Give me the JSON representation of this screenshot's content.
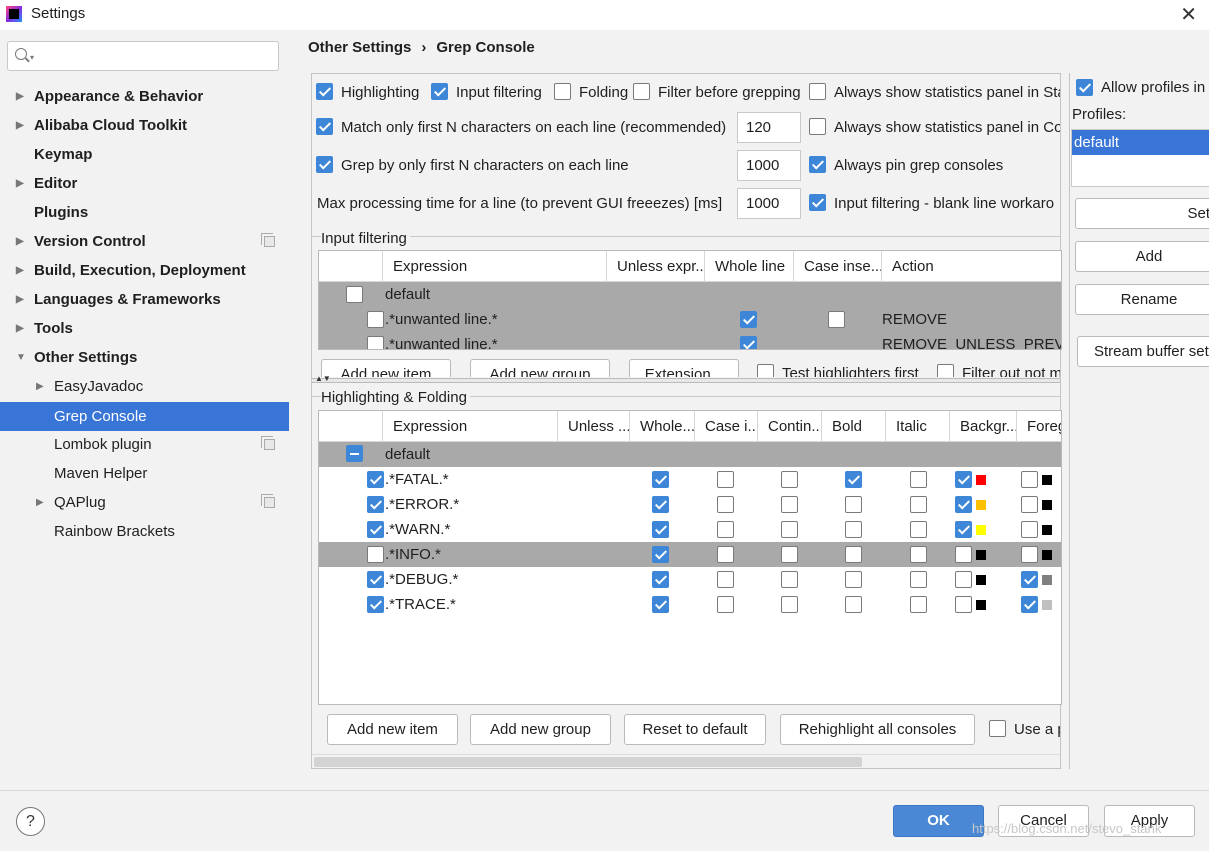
{
  "window": {
    "title": "Settings",
    "close_glyph": "✕"
  },
  "sidebar": {
    "search_placeholder": "",
    "items": [
      {
        "label": "Appearance & Behavior",
        "bold": true,
        "arrow": "▶"
      },
      {
        "label": "Alibaba Cloud Toolkit",
        "bold": true,
        "arrow": "▶"
      },
      {
        "label": "Keymap",
        "bold": true
      },
      {
        "label": "Editor",
        "bold": true,
        "arrow": "▶"
      },
      {
        "label": "Plugins",
        "bold": true
      },
      {
        "label": "Version Control",
        "bold": true,
        "arrow": "▶"
      },
      {
        "label": "Build, Execution, Deployment",
        "bold": true,
        "arrow": "▶"
      },
      {
        "label": "Languages & Frameworks",
        "bold": true,
        "arrow": "▶"
      },
      {
        "label": "Tools",
        "bold": true,
        "arrow": "▶"
      },
      {
        "label": "Other Settings",
        "bold": true,
        "arrow": "▼"
      },
      {
        "label": "EasyJavadoc",
        "arrow": "▶"
      },
      {
        "label": "Grep Console",
        "selected": true
      },
      {
        "label": "Lombok plugin"
      },
      {
        "label": "Maven Helper"
      },
      {
        "label": "QAPlug",
        "arrow": "▶"
      },
      {
        "label": "Rainbow Brackets"
      }
    ]
  },
  "breadcrumb": {
    "parent": "Other Settings",
    "separator": "›",
    "current": "Grep Console"
  },
  "options": {
    "highlighting": "Highlighting",
    "input_filtering": "Input filtering",
    "folding": "Folding",
    "filter_before": "Filter before grepping",
    "always_stats_sta": "Always show statistics panel in Sta",
    "match_first_n": "Match only first N characters on each line (recommended)",
    "match_first_n_value": "120",
    "always_stats_co": "Always show statistics panel in Co",
    "grep_first_n": "Grep by only first N characters on each line",
    "grep_first_n_value": "1000",
    "always_pin": "Always pin grep consoles",
    "max_processing": "Max processing time for a line (to prevent GUI freeezes) [ms]",
    "max_processing_value": "1000",
    "blank_line": "Input filtering - blank line workaro"
  },
  "input_filtering": {
    "title": "Input filtering",
    "headers": [
      "Expression",
      "Unless expr...",
      "Whole line",
      "Case inse...",
      "Action"
    ],
    "rows": [
      {
        "expression": "default",
        "action": ""
      },
      {
        "expression": ".*unwanted line.*",
        "action": "REMOVE"
      },
      {
        "expression": ".*unwanted line.*",
        "action": "REMOVE_UNLESS_PREVIOU"
      }
    ],
    "buttons": {
      "add_item": "Add new item",
      "add_group": "Add new group",
      "extension": "Extension...",
      "test_first": "Test highlighters first",
      "filter_out": "Filter out not m"
    }
  },
  "highlighting": {
    "title": "Highlighting & Folding",
    "headers": [
      "Expression",
      "Unless ...",
      "Whole...",
      "Case i...",
      "Contin...",
      "Bold",
      "Italic",
      "Backgr...",
      "Foreg"
    ],
    "group": "default",
    "rows": [
      {
        "expression": ".*FATAL.*",
        "bg_color": "#ff0000",
        "fg_color": "#000000"
      },
      {
        "expression": ".*ERROR.*",
        "bg_color": "#ffc000",
        "fg_color": "#000000"
      },
      {
        "expression": ".*WARN.*",
        "bg_color": "#ffff00",
        "fg_color": "#000000"
      },
      {
        "expression": ".*INFO.*",
        "bg_color": "#000000",
        "fg_color": "#000000"
      },
      {
        "expression": ".*DEBUG.*",
        "bg_color": "#000000",
        "fg_color": "#808080"
      },
      {
        "expression": ".*TRACE.*",
        "bg_color": "#000000",
        "fg_color": "#c0c0c0"
      }
    ],
    "buttons": {
      "add_item": "Add new item",
      "add_group": "Add new group",
      "reset": "Reset to default",
      "rehighlight": "Rehighlight all consoles",
      "use_a": "Use a p"
    }
  },
  "profiles": {
    "allow_label": "Allow profiles in",
    "label": "Profiles:",
    "selected": "default",
    "buttons": {
      "set": "Set",
      "add": "Add",
      "rename": "Rename",
      "stream": "Stream buffer set"
    }
  },
  "footer": {
    "help": "?",
    "ok": "OK",
    "cancel": "Cancel",
    "apply": "Apply",
    "watermark": "https://blog.csdn.net/stevo_stank"
  },
  "colors": {
    "accent": "#3875d7",
    "checkbox": "#3d86d8",
    "row_grey": "#a9a9a9"
  },
  "icons": [
    "app-icon",
    "close-icon",
    "search-icon",
    "expand-arrow-icon",
    "project-page-icon",
    "help-icon",
    "checkbox-icon"
  ]
}
